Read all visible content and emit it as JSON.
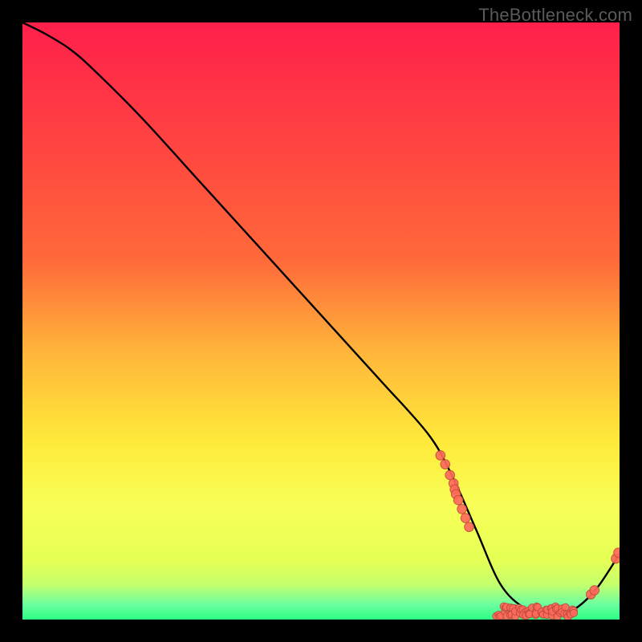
{
  "watermark": "TheBottleneck.com",
  "colors": {
    "gradient_top": "#ff1f4b",
    "gradient_mid1": "#ff6a3a",
    "gradient_mid2": "#ffb43a",
    "gradient_mid3": "#ffe93a",
    "gradient_mid4": "#f7ff57",
    "gradient_mid5": "#c6ff6a",
    "gradient_bottom": "#2bff84",
    "curve": "#000000",
    "marker_fill": "#ff6a5a",
    "marker_stroke": "#bf4a3e",
    "frame": "#000000"
  },
  "chart_data": {
    "type": "line",
    "title": "",
    "xlabel": "",
    "ylabel": "",
    "xlim": [
      0,
      100
    ],
    "ylim": [
      0,
      100
    ],
    "curve": {
      "x": [
        0,
        4,
        8,
        12,
        20,
        30,
        40,
        50,
        60,
        68,
        72,
        76,
        80,
        84,
        88,
        92,
        96,
        100
      ],
      "y": [
        100,
        98,
        95.5,
        92,
        84,
        73,
        62,
        51,
        40,
        31,
        24,
        15,
        6,
        2,
        1,
        1.5,
        5,
        11
      ]
    },
    "markers_left_cluster": {
      "comment": "dense but distinguishable markers along the descending limb near the turn",
      "points": [
        {
          "x": 70.0,
          "y": 27.5
        },
        {
          "x": 70.8,
          "y": 26.0
        },
        {
          "x": 71.6,
          "y": 24.2
        },
        {
          "x": 72.2,
          "y": 22.8
        },
        {
          "x": 72.4,
          "y": 21.8
        },
        {
          "x": 72.6,
          "y": 21.0
        },
        {
          "x": 73.0,
          "y": 20.0
        },
        {
          "x": 73.6,
          "y": 18.5
        },
        {
          "x": 74.2,
          "y": 17.0
        },
        {
          "x": 74.8,
          "y": 15.5
        }
      ]
    },
    "markers_valley": {
      "comment": "very dense smear of markers across the valley floor",
      "range_x": [
        79.5,
        92.5
      ],
      "count": 60,
      "y_center": 1.3,
      "y_jitter": 0.9
    },
    "markers_right_cluster": {
      "comment": "small cluster rising on the right limb",
      "points": [
        {
          "x": 95.2,
          "y": 4.2
        },
        {
          "x": 95.8,
          "y": 4.9
        },
        {
          "x": 99.4,
          "y": 10.2
        },
        {
          "x": 99.8,
          "y": 11.2
        }
      ]
    },
    "annotation": {
      "text": "",
      "x": 86,
      "y": 3
    }
  }
}
